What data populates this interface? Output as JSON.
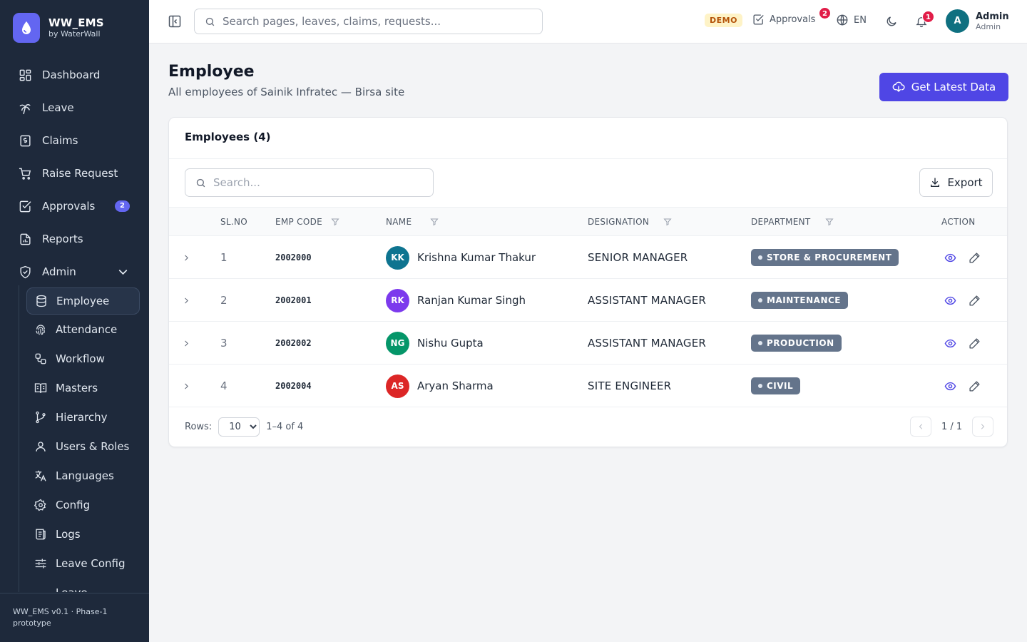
{
  "brand": {
    "name": "WW_EMS",
    "sub": "by WaterWall"
  },
  "nav": {
    "items": [
      {
        "label": "Dashboard",
        "icon": "dashboard-icon"
      },
      {
        "label": "Leave",
        "icon": "palm-tree-icon"
      },
      {
        "label": "Claims",
        "icon": "receipt-icon"
      },
      {
        "label": "Raise Request",
        "icon": "cart-icon"
      },
      {
        "label": "Approvals",
        "icon": "check-square-icon",
        "badge": "2"
      },
      {
        "label": "Reports",
        "icon": "report-icon"
      },
      {
        "label": "Admin",
        "icon": "shield-icon",
        "expanded": true
      }
    ],
    "admin_items": [
      {
        "label": "Employee",
        "icon": "database-icon",
        "active": true
      },
      {
        "label": "Attendance",
        "icon": "fingerprint-icon"
      },
      {
        "label": "Workflow",
        "icon": "workflow-icon"
      },
      {
        "label": "Masters",
        "icon": "book-icon"
      },
      {
        "label": "Hierarchy",
        "icon": "git-branch-icon"
      },
      {
        "label": "Users & Roles",
        "icon": "users-icon"
      },
      {
        "label": "Languages",
        "icon": "languages-icon"
      },
      {
        "label": "Config",
        "icon": "gear-icon"
      },
      {
        "label": "Logs",
        "icon": "logs-icon"
      },
      {
        "label": "Leave Config",
        "icon": "sliders-icon"
      },
      {
        "label": "Leave",
        "icon": ""
      }
    ]
  },
  "footer": {
    "line1": "WW_EMS v0.1 · Phase-1",
    "line2": "prototype"
  },
  "topbar": {
    "search_placeholder": "Search pages, leaves, claims, requests...",
    "demo": "DEMO",
    "approvals_label": "Approvals",
    "approvals_badge": "2",
    "lang": "EN",
    "notif_badge": "1",
    "user_initial": "A",
    "user_name": "Admin",
    "user_role": "Admin"
  },
  "page": {
    "title": "Employee",
    "subtitle": "All employees of Sainik Infratec — Birsa site",
    "latest_button": "Get Latest Data"
  },
  "table": {
    "title": "Employees (4)",
    "search_placeholder": "Search...",
    "export_label": "Export",
    "columns": {
      "slno": "SL.NO",
      "emp_code": "EMP CODE",
      "name": "NAME",
      "designation": "DESIGNATION",
      "department": "DEPARTMENT",
      "action": "ACTION"
    },
    "rows": [
      {
        "slno": "1",
        "code": "2002000",
        "initials": "KK",
        "avatar_color": "#0e7490",
        "name": "Krishna Kumar Thakur",
        "designation": "SENIOR MANAGER",
        "department": "STORE & PROCUREMENT"
      },
      {
        "slno": "2",
        "code": "2002001",
        "initials": "RK",
        "avatar_color": "#7c3aed",
        "name": "Ranjan Kumar Singh",
        "designation": "ASSISTANT MANAGER",
        "department": "MAINTENANCE"
      },
      {
        "slno": "3",
        "code": "2002002",
        "initials": "NG",
        "avatar_color": "#059669",
        "name": "Nishu Gupta",
        "designation": "ASSISTANT MANAGER",
        "department": "PRODUCTION"
      },
      {
        "slno": "4",
        "code": "2002004",
        "initials": "AS",
        "avatar_color": "#dc2626",
        "name": "Aryan Sharma",
        "designation": "SITE ENGINEER",
        "department": "CIVIL"
      }
    ],
    "rows_label": "Rows:",
    "rows_per_page": "10",
    "range": "1–4 of 4",
    "page": "1 / 1"
  },
  "colors": {
    "sidebar": "#1e293b",
    "accent": "#4f46e5",
    "badge": "#e11d48"
  }
}
